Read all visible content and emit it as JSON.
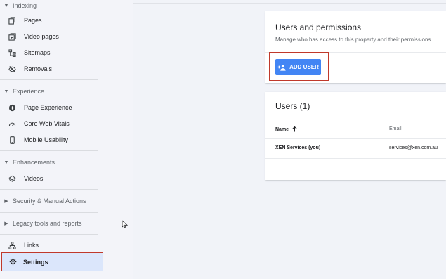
{
  "sidebar": {
    "sections": {
      "indexing": "Indexing",
      "experience": "Experience",
      "enhancements": "Enhancements",
      "security": "Security & Manual Actions",
      "legacy": "Legacy tools and reports"
    },
    "items": {
      "pages": "Pages",
      "video_pages": "Video pages",
      "sitemaps": "Sitemaps",
      "removals": "Removals",
      "page_experience": "Page Experience",
      "core_web_vitals": "Core Web Vitals",
      "mobile_usability": "Mobile Usability",
      "videos": "Videos",
      "links": "Links",
      "settings": "Settings"
    }
  },
  "permissions_card": {
    "title": "Users and permissions",
    "subtitle": "Manage who has access to this property and their permissions.",
    "add_user_label": "ADD USER"
  },
  "users_card": {
    "title": "Users (1)",
    "columns": {
      "name": "Name",
      "email": "Email"
    },
    "rows": [
      {
        "name": "XEN Services (you)",
        "email": "services@xen.com.au"
      }
    ]
  },
  "colors": {
    "accent": "#4285f4",
    "highlight": "#c0392b",
    "active_bg": "#dbe6fb"
  }
}
